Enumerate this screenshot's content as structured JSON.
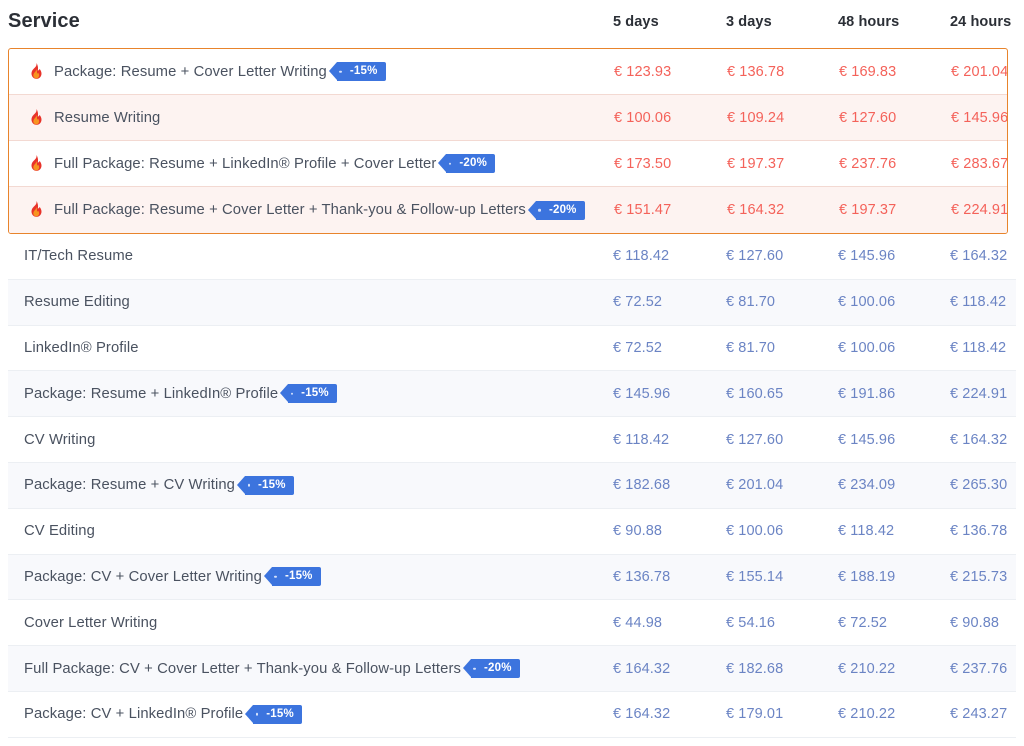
{
  "table": {
    "service_header": "Service",
    "columns": [
      "5 days",
      "3 days",
      "48 hours",
      "24 hours"
    ],
    "currency": "€",
    "colors": {
      "highlight_border": "#e8842c",
      "highlight_row_alt": "#fdf3f1",
      "highlight_price_text": "#f4625a",
      "normal_price_text": "#6b84c4",
      "normal_row_alt": "#f8f9fc",
      "badge_background": "#3c74de",
      "badge_text": "#ffffff",
      "header_text": "#2b2f36",
      "service_text": "#4a5260"
    },
    "icons": {
      "flame": "flame-icon"
    },
    "highlighted_rows": [
      {
        "name": "Package: Resume + Cover Letter Writing",
        "hot": true,
        "badge": "-15%",
        "prices": [
          "€ 123.93",
          "€ 136.78",
          "€ 169.83",
          "€ 201.04"
        ]
      },
      {
        "name": "Resume Writing",
        "hot": true,
        "badge": "",
        "prices": [
          "€ 100.06",
          "€ 109.24",
          "€ 127.60",
          "€ 145.96"
        ]
      },
      {
        "name": "Full Package: Resume + LinkedIn® Profile + Cover Letter",
        "hot": true,
        "badge": "-20%",
        "prices": [
          "€ 173.50",
          "€ 197.37",
          "€ 237.76",
          "€ 283.67"
        ]
      },
      {
        "name": "Full Package: Resume + Cover Letter + Thank-you & Follow-up Letters",
        "hot": true,
        "badge": "-20%",
        "prices": [
          "€ 151.47",
          "€ 164.32",
          "€ 197.37",
          "€ 224.91"
        ]
      }
    ],
    "rows": [
      {
        "name": "IT/Tech Resume",
        "badge": "",
        "prices": [
          "€ 118.42",
          "€ 127.60",
          "€ 145.96",
          "€ 164.32"
        ]
      },
      {
        "name": "Resume Editing",
        "badge": "",
        "prices": [
          "€ 72.52",
          "€ 81.70",
          "€ 100.06",
          "€ 118.42"
        ]
      },
      {
        "name": "LinkedIn® Profile",
        "badge": "",
        "prices": [
          "€ 72.52",
          "€ 81.70",
          "€ 100.06",
          "€ 118.42"
        ]
      },
      {
        "name": "Package: Resume + LinkedIn® Profile",
        "badge": "-15%",
        "prices": [
          "€ 145.96",
          "€ 160.65",
          "€ 191.86",
          "€ 224.91"
        ]
      },
      {
        "name": "CV Writing",
        "badge": "",
        "prices": [
          "€ 118.42",
          "€ 127.60",
          "€ 145.96",
          "€ 164.32"
        ]
      },
      {
        "name": "Package: Resume + CV Writing",
        "badge": "-15%",
        "prices": [
          "€ 182.68",
          "€ 201.04",
          "€ 234.09",
          "€ 265.30"
        ]
      },
      {
        "name": "CV Editing",
        "badge": "",
        "prices": [
          "€ 90.88",
          "€ 100.06",
          "€ 118.42",
          "€ 136.78"
        ]
      },
      {
        "name": "Package: CV + Cover Letter Writing",
        "badge": "-15%",
        "prices": [
          "€ 136.78",
          "€ 155.14",
          "€ 188.19",
          "€ 215.73"
        ]
      },
      {
        "name": "Cover Letter Writing",
        "badge": "",
        "prices": [
          "€ 44.98",
          "€ 54.16",
          "€ 72.52",
          "€ 90.88"
        ]
      },
      {
        "name": "Full Package: CV + Cover Letter + Thank-you & Follow-up Letters",
        "badge": "-20%",
        "prices": [
          "€ 164.32",
          "€ 182.68",
          "€ 210.22",
          "€ 237.76"
        ]
      },
      {
        "name": "Package: CV + LinkedIn® Profile",
        "badge": "-15%",
        "prices": [
          "€ 164.32",
          "€ 179.01",
          "€ 210.22",
          "€ 243.27"
        ]
      }
    ]
  }
}
